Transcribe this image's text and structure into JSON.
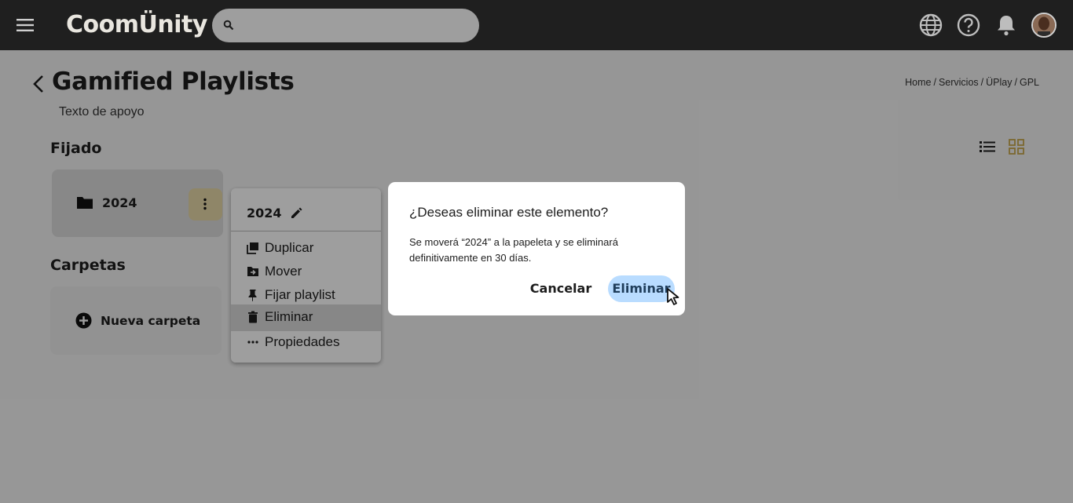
{
  "topbar": {
    "logo": "CoomÜnity",
    "search": {
      "placeholder": ""
    }
  },
  "header": {
    "title": "Gamified Playlists",
    "subtitle": "Texto de apoyo",
    "breadcrumb": [
      "Home",
      "Servicios",
      "ÜPlay",
      "GPL"
    ]
  },
  "sections": {
    "pinned_title": "Fijado",
    "folders_title": "Carpetas"
  },
  "pinned_card": {
    "label": "2024"
  },
  "new_folder": {
    "label": "Nueva carpeta"
  },
  "context_menu": {
    "title": "2024",
    "items": [
      {
        "label": "Duplicar",
        "icon": "duplicate-icon"
      },
      {
        "label": "Mover",
        "icon": "move-folder-icon"
      },
      {
        "label": "Fijar playlist",
        "icon": "pin-icon"
      },
      {
        "label": "Eliminar",
        "icon": "trash-icon"
      },
      {
        "label": "Propiedades",
        "icon": "more-horizontal-icon"
      }
    ]
  },
  "dialog": {
    "title": "¿Deseas eliminar este elemento?",
    "body": "Se moverá “2024” a la papeleta y se eliminará definitivamente en 30 días.",
    "cancel_label": "Cancelar",
    "confirm_label": "Eliminar"
  },
  "colors": {
    "topbar": "#1f1f1f",
    "accent_gold": "#c9a84c",
    "confirm_bg": "#b9dcff"
  }
}
